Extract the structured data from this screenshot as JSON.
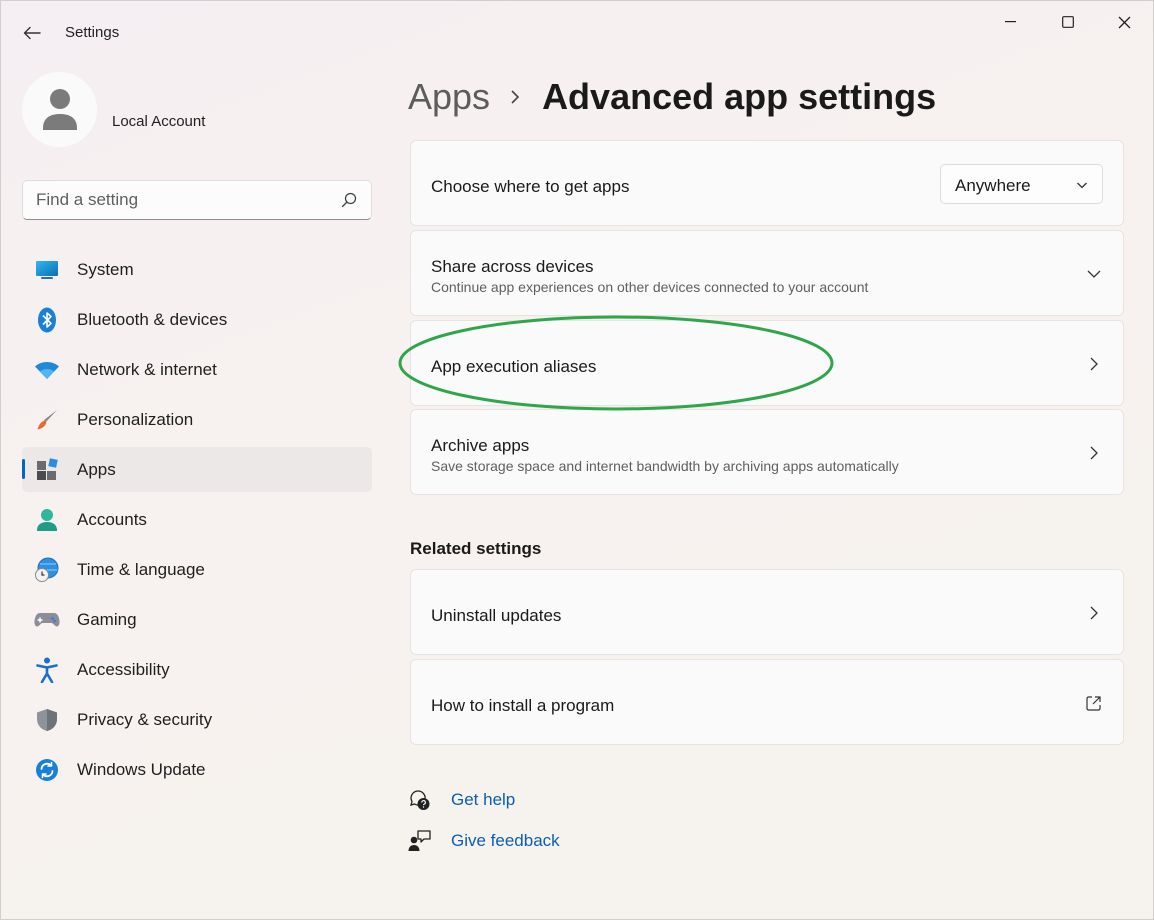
{
  "window": {
    "title": "Settings",
    "minimize_icon": "minimize-icon",
    "maximize_icon": "maximize-icon",
    "close_icon": "close-icon"
  },
  "profile": {
    "account_name": "Local Account"
  },
  "search": {
    "placeholder": "Find a setting"
  },
  "sidebar": {
    "items": [
      {
        "label": "System",
        "icon": "system-icon"
      },
      {
        "label": "Bluetooth & devices",
        "icon": "bluetooth-icon"
      },
      {
        "label": "Network & internet",
        "icon": "wifi-icon"
      },
      {
        "label": "Personalization",
        "icon": "brush-icon"
      },
      {
        "label": "Apps",
        "icon": "apps-icon",
        "active": true
      },
      {
        "label": "Accounts",
        "icon": "person-icon"
      },
      {
        "label": "Time & language",
        "icon": "globe-clock-icon"
      },
      {
        "label": "Gaming",
        "icon": "controller-icon"
      },
      {
        "label": "Accessibility",
        "icon": "accessibility-icon"
      },
      {
        "label": "Privacy & security",
        "icon": "shield-icon"
      },
      {
        "label": "Windows Update",
        "icon": "update-icon"
      }
    ]
  },
  "header": {
    "parent": "Apps",
    "current": "Advanced app settings"
  },
  "settings": {
    "choose_where": {
      "title": "Choose where to get apps",
      "value": "Anywhere"
    },
    "share_devices": {
      "title": "Share across devices",
      "subtitle": "Continue app experiences on other devices connected to your account"
    },
    "execution_aliases": {
      "title": "App execution aliases"
    },
    "archive_apps": {
      "title": "Archive apps",
      "subtitle": "Save storage space and internet bandwidth by archiving apps automatically"
    }
  },
  "related": {
    "title": "Related settings",
    "uninstall_updates": "Uninstall updates",
    "how_to_install": "How to install a program"
  },
  "help": {
    "get_help": "Get help",
    "give_feedback": "Give feedback"
  },
  "colors": {
    "accent": "#0067c0",
    "link": "#0b5fb0",
    "highlight_ellipse": "#2fa64a"
  }
}
